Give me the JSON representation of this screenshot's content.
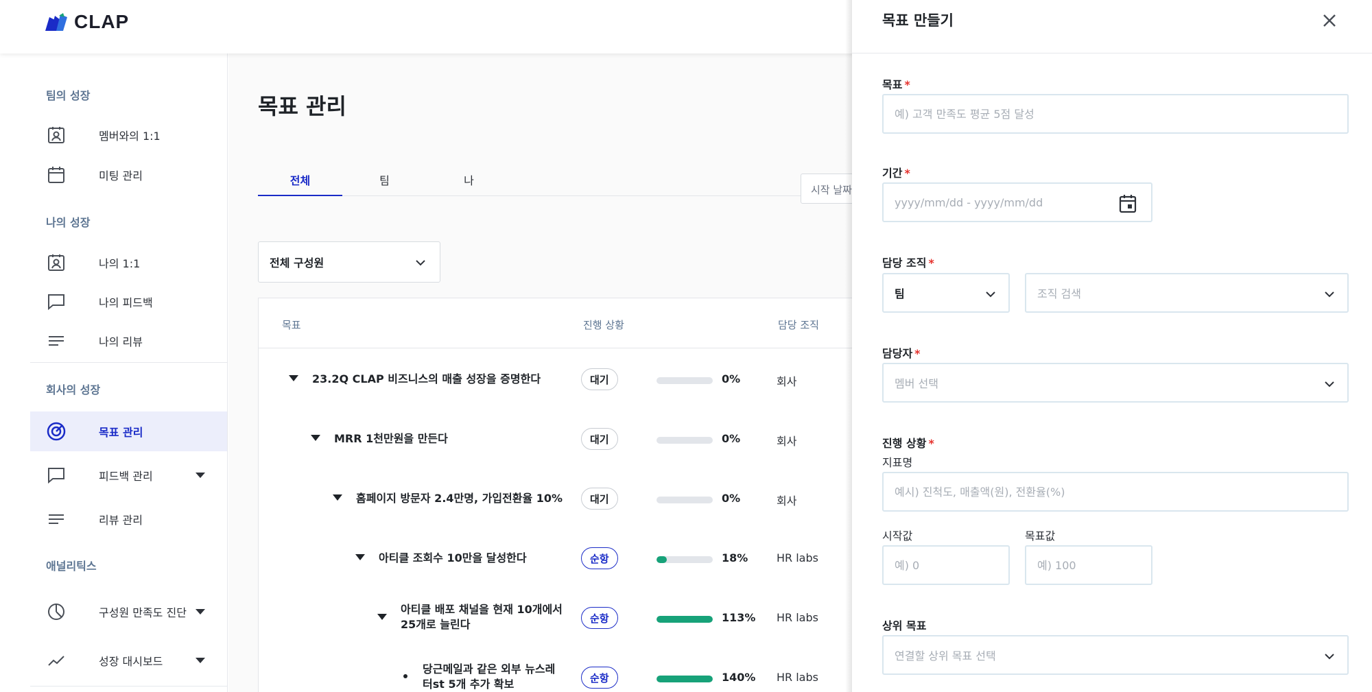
{
  "app": {
    "name": "CLAP"
  },
  "sidebar": {
    "sections": [
      {
        "title": "팀의 성장"
      },
      {
        "title": "나의 성장"
      },
      {
        "title": "회사의 성장"
      },
      {
        "title": "애널리틱스"
      }
    ],
    "items": [
      {
        "label": "멤버와의 1:1",
        "icon": "contact-badge-icon"
      },
      {
        "label": "미팅 관리",
        "icon": "calendar-icon"
      },
      {
        "label": "나의 1:1",
        "icon": "contact-badge-icon"
      },
      {
        "label": "나의 피드백",
        "icon": "chat-bubble-icon"
      },
      {
        "label": "나의 리뷰",
        "icon": "lines-icon"
      },
      {
        "label": "목표 관리",
        "icon": "target-icon",
        "active": true
      },
      {
        "label": "피드백 관리",
        "icon": "chat-bubble-icon",
        "expandable": true
      },
      {
        "label": "리뷰 관리",
        "icon": "lines-icon"
      },
      {
        "label": "구성원 만족도 진단",
        "icon": "pie-chart-icon",
        "expandable": true
      },
      {
        "label": "성장 대시보드",
        "icon": "trend-line-icon",
        "expandable": true
      }
    ]
  },
  "main": {
    "title": "목표 관리",
    "tabs": [
      {
        "label": "전체",
        "active": true
      },
      {
        "label": "팀"
      },
      {
        "label": "나"
      }
    ],
    "date_filter": {
      "placeholder": "시작 날짜"
    },
    "member_filter": {
      "value": "전체 구성원"
    },
    "table": {
      "headers": [
        "목표",
        "진행 상황",
        "담당 조직"
      ],
      "rows": [
        {
          "title": "23.2Q CLAP 비즈니스의 매출 성장을 증명한다",
          "status": "대기",
          "progress": 0,
          "progress_label": "0%",
          "org": "회사"
        },
        {
          "title": "MRR 1천만원을 만든다",
          "status": "대기",
          "progress": 0,
          "progress_label": "0%",
          "org": "회사"
        },
        {
          "title": "홈페이지 방문자 2.4만명, 가입전환율 10%",
          "status": "대기",
          "progress": 0,
          "progress_label": "0%",
          "org": "회사"
        },
        {
          "title": "아티클 조회수 10만을 달성한다",
          "status": "순항",
          "progress": 18,
          "progress_label": "18%",
          "org": "HR labs"
        },
        {
          "title": "아티클 배포 채널을 현재 10개에서 25개로 늘린다",
          "status": "순항",
          "progress": 113,
          "progress_label": "113%",
          "org": "HR labs"
        },
        {
          "title": "당근메일과 같은 외부 뉴스레터st 5개 추가 확보",
          "status": "순항",
          "progress": 140,
          "progress_label": "140%",
          "org": "HR labs"
        }
      ]
    }
  },
  "drawer": {
    "title": "목표 만들기",
    "goal": {
      "label": "목표",
      "placeholder": "예) 고객 만족도 평균 5점 달성"
    },
    "period": {
      "label": "기간",
      "placeholder": "yyyy/mm/dd - yyyy/mm/dd"
    },
    "org": {
      "label": "담당 조직",
      "type_value": "팀",
      "search_placeholder": "조직 검색"
    },
    "assignee": {
      "label": "담당자",
      "placeholder": "멤버 선택"
    },
    "progress": {
      "label": "진행 상황",
      "metric_label": "지표명",
      "metric_placeholder": "예시) 진척도, 매출액(원), 전환율(%)",
      "start_label": "시작값",
      "start_placeholder": "예) 0",
      "target_label": "목표값",
      "target_placeholder": "예) 100"
    },
    "parent_goal": {
      "label": "상위 목표",
      "placeholder": "연결할 상위 목표 선택"
    },
    "required_mark": "*"
  },
  "colors": {
    "accent": "#1a2bc7",
    "progress_fill": "#17a279",
    "required": "#e5322d",
    "section_title": "#5d7592"
  }
}
